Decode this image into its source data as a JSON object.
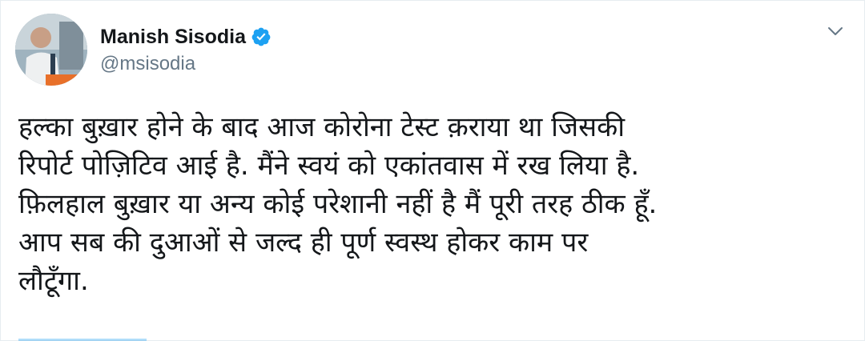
{
  "author": {
    "display_name": "Manish Sisodia",
    "handle": "@msisodia",
    "verified": true,
    "avatar_icon": "profile-photo"
  },
  "tweet": {
    "text": "हल्का बुख़ार होने के बाद आज कोरोना टेस्ट क़राया था जिसकी\nरिपोर्ट पोज़िटिव आई है. मैंने स्वयं को एकांतवास में रख लिया है.\nफ़िलहाल बुख़ार या अन्य कोई परेशानी नहीं है मैं पूरी तरह ठीक हूँ.\nआप सब की दुआओं से जल्द ही पूर्ण स्वस्थ होकर काम पर\nलौटूँगा."
  },
  "icons": {
    "verified": "verified-badge-icon",
    "menu": "chevron-down-icon"
  },
  "colors": {
    "verified_blue": "#1da1f2",
    "name": "#14171a",
    "handle": "#657786"
  }
}
